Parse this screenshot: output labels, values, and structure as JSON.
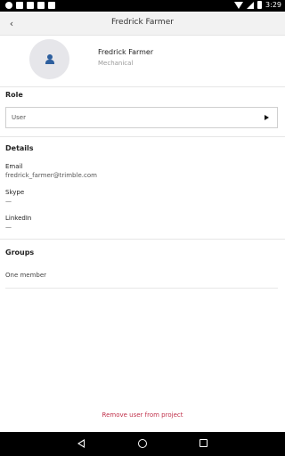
{
  "status_bar": {
    "time": "3:29",
    "left_icons": [
      "settings-icon",
      "image-icon",
      "youtube-icon",
      "photo-icon",
      "trimble-icon"
    ],
    "right_icons": [
      "wifi-icon",
      "signal-icon",
      "battery-icon"
    ]
  },
  "header": {
    "title": "Fredrick Farmer",
    "back_icon": "chevron-left-icon",
    "back_glyph": "‹"
  },
  "profile": {
    "name": "Fredrick Farmer",
    "department": "Mechanical",
    "avatar_icon": "person-icon"
  },
  "role": {
    "title": "Role",
    "value": "User",
    "dropdown_icon": "triangle-right-icon"
  },
  "details": {
    "title": "Details",
    "fields": [
      {
        "label": "Email",
        "value": "fredrick_farmer@trimble.com"
      },
      {
        "label": "Skype",
        "value": "—"
      },
      {
        "label": "LinkedIn",
        "value": "—"
      }
    ]
  },
  "groups": {
    "title": "Groups",
    "summary": "One member"
  },
  "actions": {
    "remove_label": "Remove user from project"
  },
  "colors": {
    "accent": "#2d5f9e",
    "danger": "#c0304a",
    "header_bg": "#f2f2f2"
  }
}
